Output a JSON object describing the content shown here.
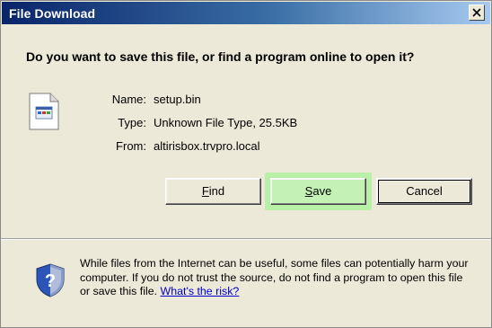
{
  "window": {
    "title": "File Download",
    "close_glyph": "×"
  },
  "dialog": {
    "question": "Do you want to save this file, or find a program online to open it?",
    "file_icon": "document-icon",
    "fields": {
      "name_label": "Name:",
      "name_value": "setup.bin",
      "type_label": "Type:",
      "type_value": "Unknown File Type, 25.5KB",
      "from_label": "From:",
      "from_value": "altirisbox.trvpro.local"
    },
    "buttons": {
      "find": "Find",
      "save": "Save",
      "cancel": "Cancel"
    }
  },
  "warning": {
    "icon": "shield-icon",
    "text": "While files from the Internet can be useful, some files can potentially harm your computer. If you do not trust the source, do not find a program to open this file or save this file.",
    "link": "What's the risk?"
  },
  "colors": {
    "title_bar_start": "#0a246a",
    "title_bar_end": "#a6caf0",
    "dialog_bg": "#ece9d8",
    "save_highlight": "#b8f0a8",
    "link": "#0000cc"
  }
}
